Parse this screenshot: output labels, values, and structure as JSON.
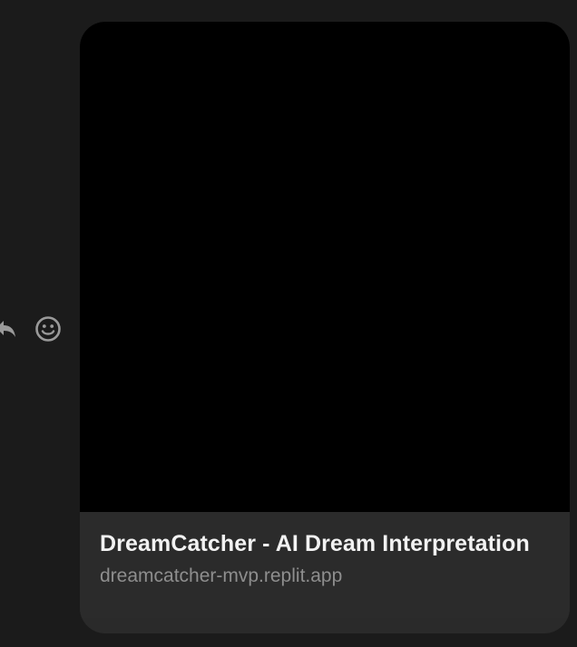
{
  "reactions": {
    "reply_icon": "reply-arrow",
    "emoji_icon": "smiley-face"
  },
  "link_preview": {
    "title": "DreamCatcher - AI Dream Interpretation",
    "domain": "dreamcatcher-mvp.replit.app",
    "image_color": "#000000"
  },
  "colors": {
    "background": "#1b1b1b",
    "card_footer": "#2b2b2b",
    "title_text": "#f2f2f2",
    "domain_text": "#8e8e8e",
    "icon": "#9a9a9a"
  }
}
